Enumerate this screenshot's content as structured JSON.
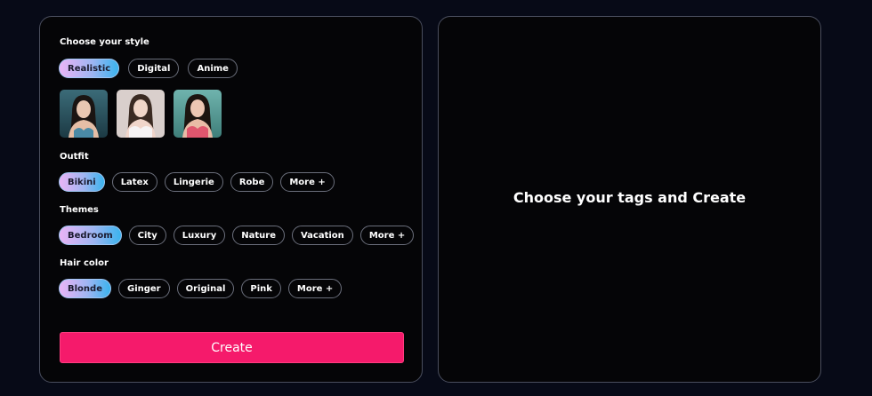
{
  "style_section": {
    "title": "Choose your style",
    "options": [
      {
        "label": "Realistic",
        "selected": true
      },
      {
        "label": "Digital",
        "selected": false
      },
      {
        "label": "Anime",
        "selected": false
      }
    ],
    "thumbnails": [
      "portrait-1",
      "portrait-2",
      "portrait-3"
    ]
  },
  "outfit_section": {
    "title": "Outfit",
    "options": [
      {
        "label": "Bikini",
        "selected": true
      },
      {
        "label": "Latex",
        "selected": false
      },
      {
        "label": "Lingerie",
        "selected": false
      },
      {
        "label": "Robe",
        "selected": false
      },
      {
        "label": "More +",
        "selected": false
      }
    ]
  },
  "themes_section": {
    "title": "Themes",
    "options": [
      {
        "label": "Bedroom",
        "selected": true
      },
      {
        "label": "City",
        "selected": false
      },
      {
        "label": "Luxury",
        "selected": false
      },
      {
        "label": "Nature",
        "selected": false
      },
      {
        "label": "Vacation",
        "selected": false
      },
      {
        "label": "More +",
        "selected": false
      }
    ]
  },
  "hair_section": {
    "title": "Hair color",
    "options": [
      {
        "label": "Blonde",
        "selected": true
      },
      {
        "label": "Ginger",
        "selected": false
      },
      {
        "label": "Original",
        "selected": false
      },
      {
        "label": "Pink",
        "selected": false
      },
      {
        "label": "More +",
        "selected": false
      }
    ]
  },
  "create_button_label": "Create",
  "preview": {
    "placeholder": "Choose your tags and Create"
  },
  "colors": {
    "background": "#070a17",
    "panel": "#050507",
    "accent": "#f51a6b",
    "chip_gradient": [
      "#eab4f6",
      "#9fb5f2",
      "#3ab4ee"
    ]
  }
}
